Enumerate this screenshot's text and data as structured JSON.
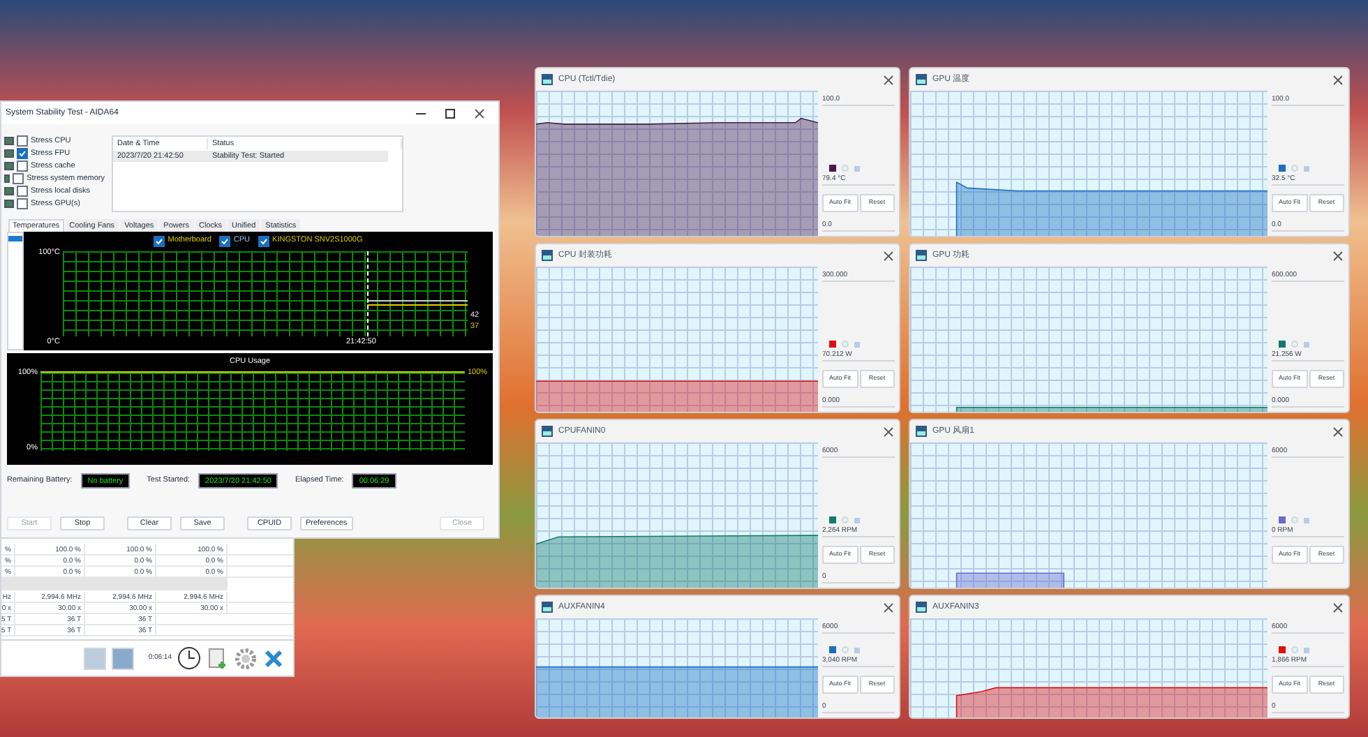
{
  "aida_window": {
    "title": "System Stability Test - AIDA64",
    "stress_options": [
      {
        "label": "Stress CPU",
        "checked": false
      },
      {
        "label": "Stress FPU",
        "checked": true
      },
      {
        "label": "Stress cache",
        "checked": false
      },
      {
        "label": "Stress system memory",
        "checked": false
      },
      {
        "label": "Stress local disks",
        "checked": false
      },
      {
        "label": "Stress GPU(s)",
        "checked": false
      }
    ],
    "log": {
      "columns": [
        "Date & Time",
        "Status"
      ],
      "rows": [
        [
          "2023/7/20 21:42:50",
          "Stability Test: Started"
        ]
      ]
    },
    "tabs": [
      {
        "label": "Temperatures",
        "selected": true
      },
      {
        "label": "Cooling Fans",
        "selected": false
      },
      {
        "label": "Voltages",
        "selected": false
      },
      {
        "label": "Powers",
        "selected": false
      },
      {
        "label": "Clocks",
        "selected": false
      },
      {
        "label": "Unified",
        "selected": false
      },
      {
        "label": "Statistics",
        "selected": false
      }
    ],
    "temp_graph": {
      "legend": [
        {
          "label": "Motherboard",
          "checked": true
        },
        {
          "label": "CPU",
          "checked": true
        },
        {
          "label": "KINGSTON SNV2S1000G",
          "checked": true
        }
      ],
      "y_max": "100°C",
      "y_min": "0°C",
      "time": "21:42:50",
      "values": [
        "42",
        "37"
      ]
    },
    "usage_graph": {
      "title": "CPU Usage",
      "y_max": "100%",
      "y_min": "0%",
      "value": "100%"
    },
    "status": [
      {
        "label": "Remaining Battery:",
        "value": "No battery"
      },
      {
        "label": "Test Started:",
        "value": "2023/7/20 21:42:50"
      },
      {
        "label": "Elapsed Time:",
        "value": "00:06:29"
      }
    ],
    "buttons": [
      {
        "label": "Start",
        "disabled": true
      },
      {
        "label": "Stop",
        "disabled": false
      },
      {
        "label": "Clear",
        "disabled": false
      },
      {
        "label": "Save",
        "disabled": false
      },
      {
        "label": "CPUID",
        "disabled": false
      },
      {
        "label": "Preferences",
        "disabled": false
      },
      {
        "label": "Close",
        "disabled": true
      }
    ]
  },
  "back_window": {
    "rows": [
      {
        "kind": "data",
        "cells": [
          "%",
          "100.0 %",
          "100.0 %",
          "100.0 %"
        ]
      },
      {
        "kind": "data",
        "cells": [
          "%",
          "0.0 %",
          "0.0 %",
          "0.0 %"
        ]
      },
      {
        "kind": "data",
        "cells": [
          "%",
          "0.0 %",
          "0.0 %",
          "0.0 %"
        ]
      },
      {
        "kind": "separator"
      },
      {
        "kind": "data",
        "cells": [
          "Hz",
          "2,994.6 MHz",
          "2,994.6 MHz",
          "2,994.6 MHz"
        ]
      },
      {
        "kind": "data",
        "cells": [
          "0 x",
          "30.00 x",
          "30.00 x",
          "30.00 x"
        ]
      },
      {
        "kind": "data",
        "cells": [
          "5 T",
          "36 T",
          "36 T"
        ]
      },
      {
        "kind": "data",
        "cells": [
          "5 T",
          "36 T",
          "36 T"
        ]
      }
    ],
    "timer": "0:06:14"
  },
  "graphs": [
    {
      "title": "CPU (Tctl/Tdie)",
      "max": "100.0",
      "reading": "79.4 °C",
      "min": "0.0",
      "color": "#4a1a4a",
      "buttons": [
        "Auto Fit",
        "Reset"
      ]
    },
    {
      "title": "GPU 温度",
      "max": "100.0",
      "reading": "32.5 °C",
      "min": "0.0",
      "color": "#1a6fc0",
      "buttons": [
        "Auto Fit",
        "Reset"
      ]
    },
    {
      "title": "CPU 封装功耗",
      "max": "300.000",
      "reading": "70.212 W",
      "min": "0.000",
      "color": "#e01010",
      "buttons": [
        "Auto Fit",
        "Reset"
      ]
    },
    {
      "title": "GPU 功耗",
      "max": "600.000",
      "reading": "21.256 W",
      "min": "0.000",
      "color": "#127a6a",
      "buttons": [
        "Auto Fit",
        "Reset"
      ]
    },
    {
      "title": "CPUFANIN0",
      "max": "6000",
      "reading": "2,264 RPM",
      "min": "0",
      "color": "#127a6a",
      "buttons": [
        "Auto Fit",
        "Reset"
      ]
    },
    {
      "title": "GPU 风扇1",
      "max": "6000",
      "reading": "0 RPM",
      "color": "#6a6ad0",
      "buttons": [
        "Auto Fit",
        "Reset"
      ]
    },
    {
      "title": "AUXFANIN4",
      "max": "6000",
      "reading": "3,040 RPM",
      "min": "0",
      "color": "#1a6fc0",
      "buttons": [
        "Auto Fit",
        "Reset"
      ]
    },
    {
      "title": "AUXFANIN3",
      "max": "6000",
      "reading": "1,866 RPM",
      "min": "0",
      "color": "#e01010",
      "buttons": [
        "Auto Fit",
        "Reset"
      ]
    }
  ]
}
